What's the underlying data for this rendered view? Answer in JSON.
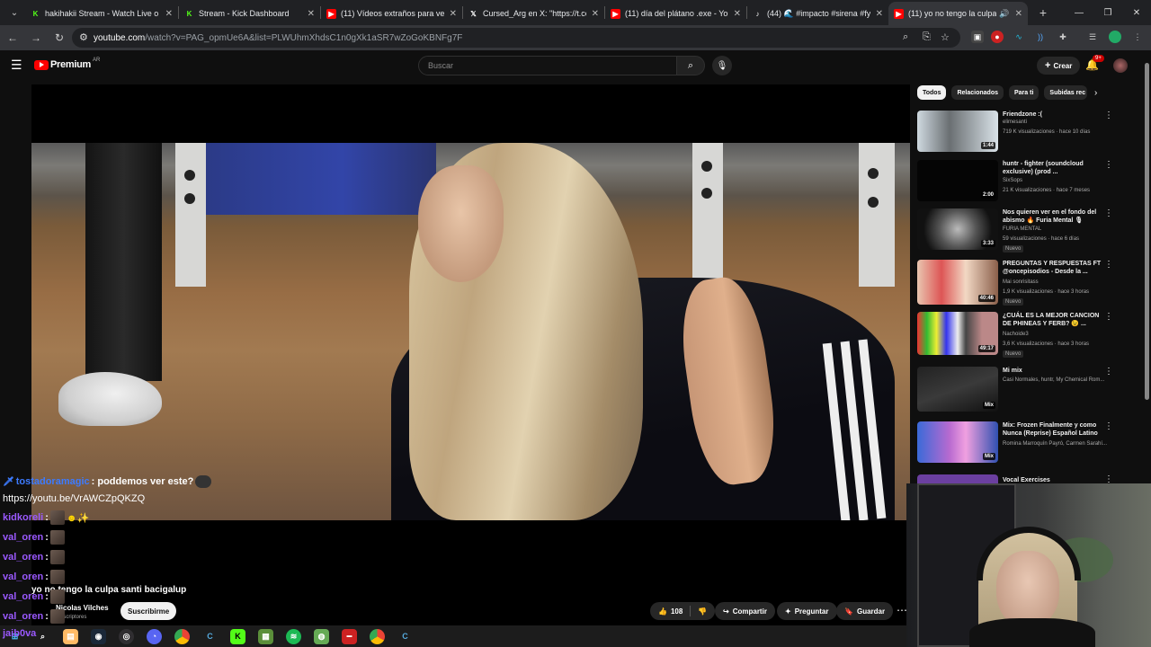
{
  "browser": {
    "tabs": [
      {
        "title": "hakihakii Stream - Watch Live o",
        "icon": "kick",
        "color": "#53fc18"
      },
      {
        "title": "Stream - Kick Dashboard",
        "icon": "kick",
        "color": "#53fc18"
      },
      {
        "title": "(11) Vídeos extraños para ver e",
        "icon": "youtube",
        "color": "#ff0000"
      },
      {
        "title": "Cursed_Arg en X: \"https://t.co/j",
        "icon": "x",
        "color": "#ffffff"
      },
      {
        "title": "(11) día del plátano .exe - YouT",
        "icon": "youtube",
        "color": "#ff0000"
      },
      {
        "title": "(44) 🌊 #impacto #sirena #fy",
        "icon": "tiktok",
        "color": "#ffffff"
      },
      {
        "title": "(11) yo no tengo la culpa s",
        "icon": "youtube",
        "color": "#ff0000"
      }
    ],
    "url_domain": "youtube.com",
    "url_rest": "/watch?v=PAG_opmUe6A&list=PLWUhmXhdsC1n0gXk1aSR7wZoGoKBNFg7F"
  },
  "youtube": {
    "logo": "Premium",
    "logo_region": "AR",
    "search_placeholder": "Buscar",
    "create_label": "Crear",
    "notif_count": "9+",
    "video": {
      "title": "yo no tengo la culpa santi bacigalup",
      "channel": "Nicolas Vilches",
      "subscribers": "suscriptores",
      "subscribe_label": "Suscribirme",
      "likes": "108",
      "share_label": "Compartir",
      "ask_label": "Preguntar",
      "save_label": "Guardar"
    },
    "chips": [
      "Todos",
      "Relacionados",
      "Para ti",
      "Subidas rec"
    ],
    "recommendations": [
      {
        "title": "Friendzone :(",
        "channel": "elimesanti",
        "meta": "719 K visualizaciones · hace 10 días",
        "duration": "1:44",
        "new": ""
      },
      {
        "title": "huntr - fighter (soundcloud exclusive) (prod ...",
        "channel": "SixSops",
        "meta": "21 K visualizaciones · hace 7 meses",
        "duration": "2:00",
        "new": ""
      },
      {
        "title": "Nos quieren ver en el fondo del abismo 🔥 Furia Mental 🎙",
        "channel": "FURIA MENTAL",
        "meta": "59 visualizaciones · hace 6 días",
        "duration": "3:33",
        "new": "Nuevo"
      },
      {
        "title": "PREGUNTAS Y RESPUESTAS FT @oncepisodios - Desde la ...",
        "channel": "Mai sonrisitass",
        "meta": "1,9 K visualizaciones · hace 3 horas",
        "duration": "40:46",
        "new": "Nuevo"
      },
      {
        "title": "¿CUÁL ES LA MEJOR CANCION DE PHINEAS Y FERB? 😉 ...",
        "channel": "Nachoide3",
        "meta": "3,6 K visualizaciones · hace 3 horas",
        "duration": "49:17",
        "new": "Nuevo"
      },
      {
        "title": "Mi mix",
        "channel": "Casi Normales, huntr, My Chemical Rom...",
        "meta": "",
        "duration": "Mix",
        "new": ""
      },
      {
        "title": "Mix: Frozen  Finalmente y como Nunca (Reprise) Español Latino",
        "channel": "Romina Marroquín Payró, Carmen Sarahí...",
        "meta": "",
        "duration": "Mix",
        "new": ""
      },
      {
        "title": "Vocal Exercises",
        "channel": "",
        "meta": "",
        "duration": "",
        "new": ""
      }
    ]
  },
  "chat": [
    {
      "user": "tostadoramagic",
      "text": ": poddemos ver este?",
      "color": "#3d7bff"
    },
    {
      "user": "",
      "text": "https://youtu.be/VrAWCZpQKZQ",
      "color": "#ffffff"
    },
    {
      "user": "kidkoreli",
      "text": ":",
      "color": "#9b59ff"
    },
    {
      "user": "val_oren",
      "text": ":",
      "color": "#9b59ff"
    },
    {
      "user": "val_oren",
      "text": ":",
      "color": "#9b59ff"
    },
    {
      "user": "val_oren",
      "text": ":",
      "color": "#9b59ff"
    },
    {
      "user": "val_oren",
      "text": ":",
      "color": "#9b59ff"
    },
    {
      "user": "val_oren",
      "text": ":",
      "color": "#9b59ff"
    },
    {
      "user": "jaib0va",
      "text": "",
      "color": "#9b59ff"
    }
  ],
  "taskbar": [
    "windows-icon",
    "search-icon",
    "steam-icon",
    "obs-icon",
    "discord-icon",
    "chrome-icon",
    "app-icon",
    "kick-icon",
    "minecraft-icon",
    "spotify-icon",
    "app-icon",
    "app-icon",
    "chrome-icon",
    "app-icon"
  ]
}
